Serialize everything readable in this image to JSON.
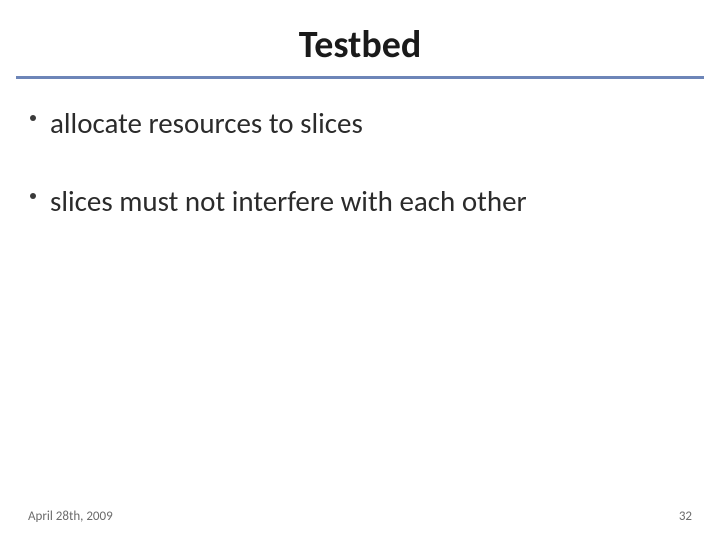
{
  "title": "Testbed",
  "bullets": [
    "allocate resources to slices",
    "slices must not interfere with each other"
  ],
  "footer": {
    "date": "April 28th, 2009",
    "page": "32"
  }
}
